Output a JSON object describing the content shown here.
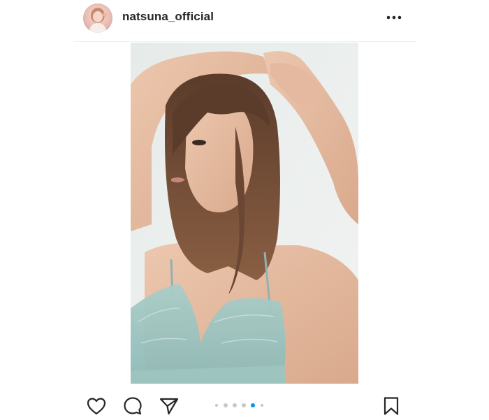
{
  "header": {
    "username": "natsuna_official",
    "avatar_icon": "profile-photo",
    "more_icon": "more-options-icon"
  },
  "post": {
    "image_icon": "post-photo"
  },
  "actions": {
    "like_icon": "heart-icon",
    "comment_icon": "comment-icon",
    "share_icon": "send-icon",
    "save_icon": "bookmark-icon"
  },
  "carousel": {
    "total_dots": 5,
    "active_index": 3,
    "active_color": "#0095f6",
    "inactive_color": "#c7c7c7"
  }
}
